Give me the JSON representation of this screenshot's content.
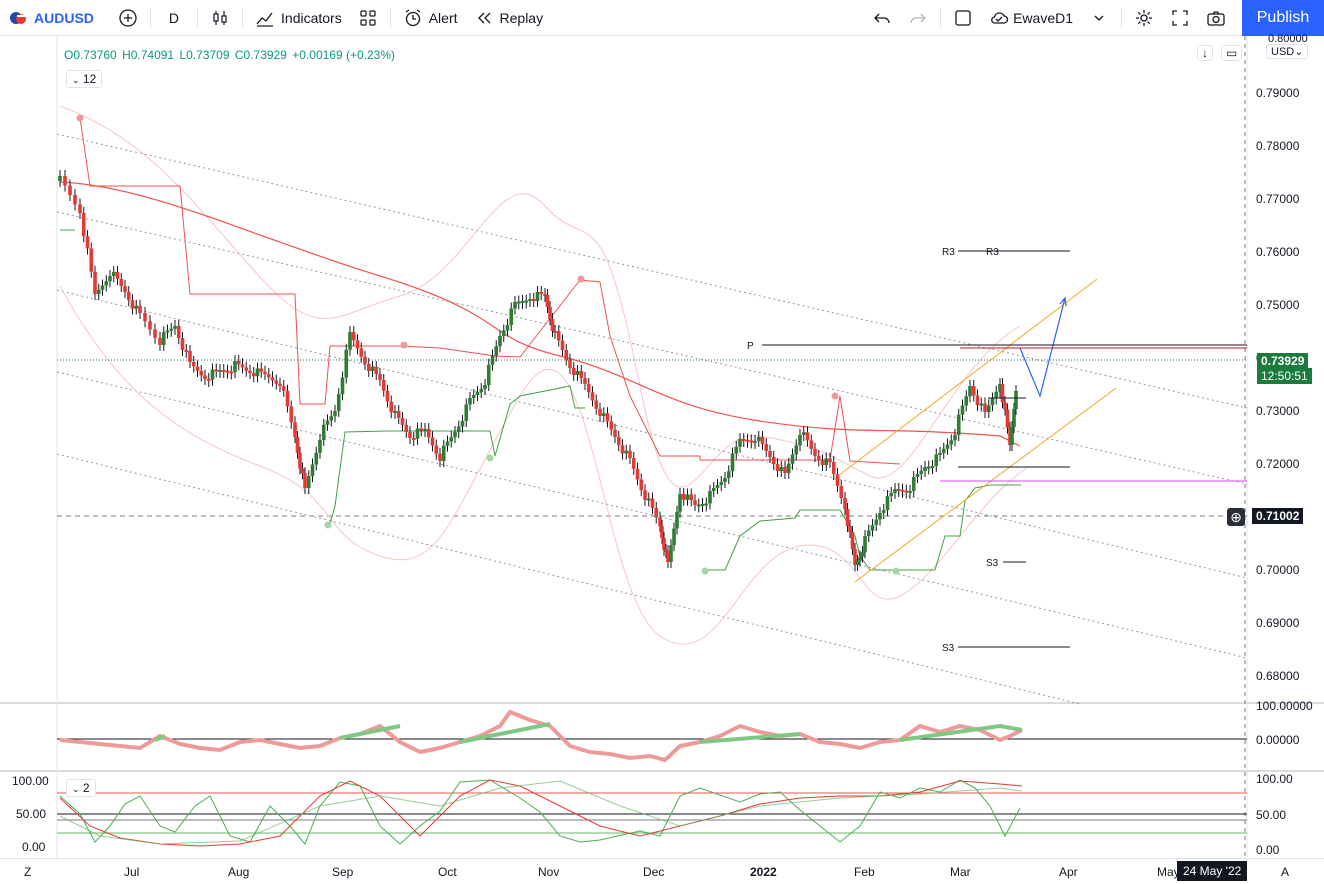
{
  "toolbar": {
    "symbol": "AUDUSD",
    "interval": "D",
    "indicators_label": "Indicators",
    "alert_label": "Alert",
    "replay_label": "Replay",
    "layout_name": "EwaveD1",
    "publish_label": "Publish"
  },
  "legend": {
    "open": "O0.73760",
    "high": "H0.74091",
    "low": "L0.73709",
    "close": "C0.73929",
    "change": "+0.00169 (+0.23%)",
    "indicator_count": "12",
    "sub_indicator_count": "2"
  },
  "price_axis": {
    "currency": "USD",
    "top_label": "0.80000",
    "labels": [
      "0.79000",
      "0.78000",
      "0.77000",
      "0.76000",
      "0.75000",
      "0.74000",
      "0.73000",
      "0.72000",
      "0.71000",
      "0.70000",
      "0.69000",
      "0.68000"
    ],
    "current_price": "0.73929",
    "countdown": "12:50:51",
    "crosshair_price": "0.71002"
  },
  "osc1_axis": {
    "labels": [
      "100.00000",
      "0.00000"
    ]
  },
  "osc2_axis": {
    "labels": [
      "100.00",
      "50.00",
      "0.00"
    ],
    "left_labels": [
      "100.00",
      "50.00",
      "0.00"
    ]
  },
  "time_axis": {
    "labels": [
      "Jul",
      "Aug",
      "Sep",
      "Oct",
      "Nov",
      "Dec",
      "2022",
      "Feb",
      "Mar",
      "Apr",
      "May"
    ],
    "crosshair_date": "24 May '22",
    "left_btn": "Z",
    "right_btn": "A"
  },
  "pivots": {
    "r3_a": "R3",
    "r3_b": "R3",
    "p": "P",
    "s3_a": "S3",
    "s3_b": "S3"
  },
  "colors": {
    "up": "#26a69a",
    "up_candle": "#2e7d32",
    "down": "#e53935",
    "accent": "#2962ff",
    "price_tag": "#1b7b3f"
  }
}
